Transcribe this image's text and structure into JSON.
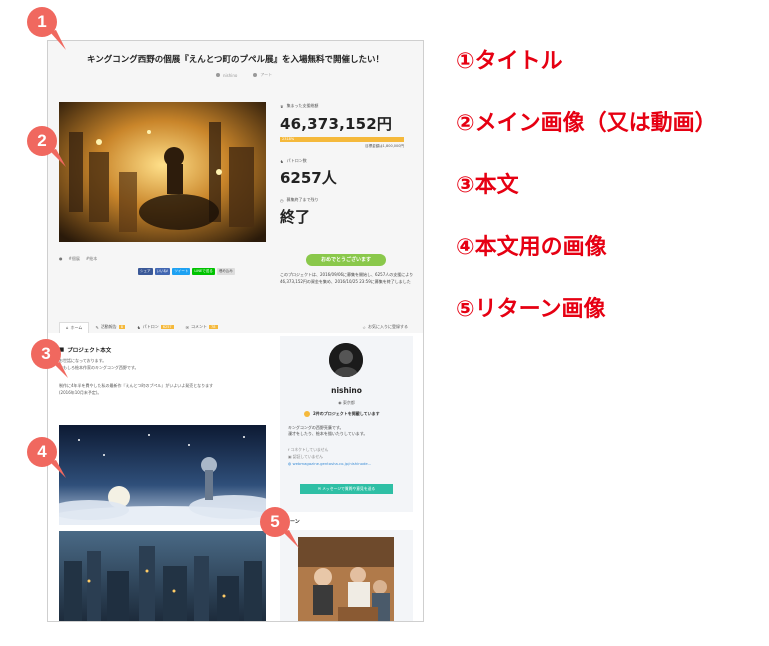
{
  "project": {
    "title": "キングコング西野の個展『えんとつ町のプペル展』を入場無料で開催したい！",
    "author": "nishino",
    "category": "アート",
    "tags": [
      "#個展",
      "#絵本"
    ],
    "share_buttons": [
      {
        "label": "シェア",
        "color": "#3b5998"
      },
      {
        "label": "いいね!",
        "color": "#4267b2"
      },
      {
        "label": "ツイート",
        "color": "#1da1f2"
      },
      {
        "label": "LINEで送る",
        "color": "#00c300"
      },
      {
        "label": "埋め込み",
        "color": "#dddddd"
      }
    ]
  },
  "stats": {
    "raised_label": "集まった支援総額",
    "raised_amount": "46,373,152円",
    "progress_pct_label": "2318%",
    "progress_fraction": 1.0,
    "target_label": "目標金額は1,800,000円",
    "supporters_label": "パトロン数",
    "supporters": "6257人",
    "remaining_label": "募集終了まで残り",
    "remaining": "終了",
    "cta_label": "おめでとうございます",
    "summary": "このプロジェクトは、2016/09/06に募集を開始し、6257人の支援により46,373,152円の資金を集め、2016/10/25 23:59に募集を終了しました"
  },
  "tabs": [
    {
      "label": "ホーム",
      "count": ""
    },
    {
      "label": "活動報告",
      "count": "8"
    },
    {
      "label": "パトロン",
      "count": "6257"
    },
    {
      "label": "コメント",
      "count": "78"
    }
  ],
  "tabs_right": "お気に入りに登録する",
  "body": {
    "heading": "プロジェクト本文",
    "text1": "お世話になっております。\nおもしろ絵本作家のキングコング西野です。",
    "text2": "制作に4年半を費やした私の最新作『えんとつ町のプペル』がいよいよ発売となります\n(2016年10月末予定)。"
  },
  "owner": {
    "name": "nishino",
    "location": "東京都",
    "badge": "2件のプロジェクトを掲載しています",
    "intro": "キングコングの西野亮廣です。\n漫才をしたり、絵本を描いたりしています。",
    "links": [
      "コネクトしていません",
      "認証していません",
      "webmagazine.gentosha.co.jp/nishinode..."
    ],
    "message_button": "メッセージで質問や意見を送る"
  },
  "returns_heading": "リターン",
  "markers": [
    {
      "num": "1",
      "color": "#f0685f"
    },
    {
      "num": "2",
      "color": "#f0685f"
    },
    {
      "num": "3",
      "color": "#f0685f"
    },
    {
      "num": "4",
      "color": "#f0685f"
    },
    {
      "num": "5",
      "color": "#f0685f"
    }
  ],
  "legend": [
    "①タイトル",
    "②メイン画像（又は動画）",
    "③本文",
    "④本文用の画像",
    "⑤リターン画像"
  ]
}
